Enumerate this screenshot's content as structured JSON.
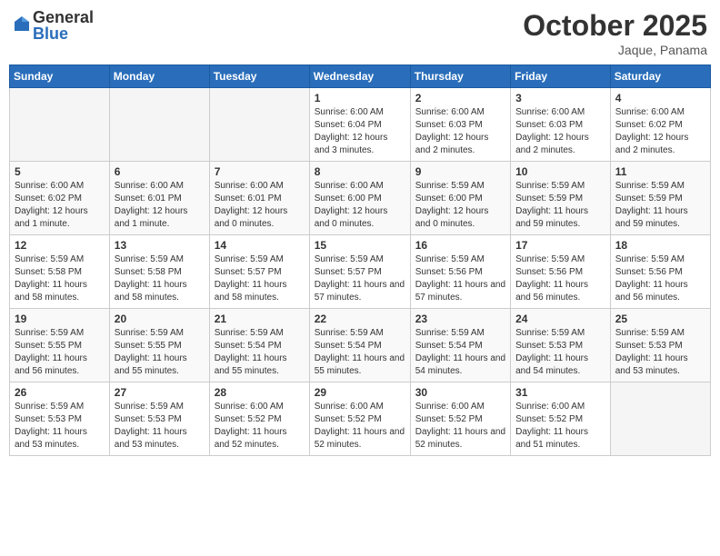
{
  "header": {
    "logo_general": "General",
    "logo_blue": "Blue",
    "month_title": "October 2025",
    "location": "Jaque, Panama"
  },
  "days_of_week": [
    "Sunday",
    "Monday",
    "Tuesday",
    "Wednesday",
    "Thursday",
    "Friday",
    "Saturday"
  ],
  "weeks": [
    [
      {
        "day": "",
        "info": ""
      },
      {
        "day": "",
        "info": ""
      },
      {
        "day": "",
        "info": ""
      },
      {
        "day": "1",
        "info": "Sunrise: 6:00 AM\nSunset: 6:04 PM\nDaylight: 12 hours and 3 minutes."
      },
      {
        "day": "2",
        "info": "Sunrise: 6:00 AM\nSunset: 6:03 PM\nDaylight: 12 hours and 2 minutes."
      },
      {
        "day": "3",
        "info": "Sunrise: 6:00 AM\nSunset: 6:03 PM\nDaylight: 12 hours and 2 minutes."
      },
      {
        "day": "4",
        "info": "Sunrise: 6:00 AM\nSunset: 6:02 PM\nDaylight: 12 hours and 2 minutes."
      }
    ],
    [
      {
        "day": "5",
        "info": "Sunrise: 6:00 AM\nSunset: 6:02 PM\nDaylight: 12 hours and 1 minute."
      },
      {
        "day": "6",
        "info": "Sunrise: 6:00 AM\nSunset: 6:01 PM\nDaylight: 12 hours and 1 minute."
      },
      {
        "day": "7",
        "info": "Sunrise: 6:00 AM\nSunset: 6:01 PM\nDaylight: 12 hours and 0 minutes."
      },
      {
        "day": "8",
        "info": "Sunrise: 6:00 AM\nSunset: 6:00 PM\nDaylight: 12 hours and 0 minutes."
      },
      {
        "day": "9",
        "info": "Sunrise: 5:59 AM\nSunset: 6:00 PM\nDaylight: 12 hours and 0 minutes."
      },
      {
        "day": "10",
        "info": "Sunrise: 5:59 AM\nSunset: 5:59 PM\nDaylight: 11 hours and 59 minutes."
      },
      {
        "day": "11",
        "info": "Sunrise: 5:59 AM\nSunset: 5:59 PM\nDaylight: 11 hours and 59 minutes."
      }
    ],
    [
      {
        "day": "12",
        "info": "Sunrise: 5:59 AM\nSunset: 5:58 PM\nDaylight: 11 hours and 58 minutes."
      },
      {
        "day": "13",
        "info": "Sunrise: 5:59 AM\nSunset: 5:58 PM\nDaylight: 11 hours and 58 minutes."
      },
      {
        "day": "14",
        "info": "Sunrise: 5:59 AM\nSunset: 5:57 PM\nDaylight: 11 hours and 58 minutes."
      },
      {
        "day": "15",
        "info": "Sunrise: 5:59 AM\nSunset: 5:57 PM\nDaylight: 11 hours and 57 minutes."
      },
      {
        "day": "16",
        "info": "Sunrise: 5:59 AM\nSunset: 5:56 PM\nDaylight: 11 hours and 57 minutes."
      },
      {
        "day": "17",
        "info": "Sunrise: 5:59 AM\nSunset: 5:56 PM\nDaylight: 11 hours and 56 minutes."
      },
      {
        "day": "18",
        "info": "Sunrise: 5:59 AM\nSunset: 5:56 PM\nDaylight: 11 hours and 56 minutes."
      }
    ],
    [
      {
        "day": "19",
        "info": "Sunrise: 5:59 AM\nSunset: 5:55 PM\nDaylight: 11 hours and 56 minutes."
      },
      {
        "day": "20",
        "info": "Sunrise: 5:59 AM\nSunset: 5:55 PM\nDaylight: 11 hours and 55 minutes."
      },
      {
        "day": "21",
        "info": "Sunrise: 5:59 AM\nSunset: 5:54 PM\nDaylight: 11 hours and 55 minutes."
      },
      {
        "day": "22",
        "info": "Sunrise: 5:59 AM\nSunset: 5:54 PM\nDaylight: 11 hours and 55 minutes."
      },
      {
        "day": "23",
        "info": "Sunrise: 5:59 AM\nSunset: 5:54 PM\nDaylight: 11 hours and 54 minutes."
      },
      {
        "day": "24",
        "info": "Sunrise: 5:59 AM\nSunset: 5:53 PM\nDaylight: 11 hours and 54 minutes."
      },
      {
        "day": "25",
        "info": "Sunrise: 5:59 AM\nSunset: 5:53 PM\nDaylight: 11 hours and 53 minutes."
      }
    ],
    [
      {
        "day": "26",
        "info": "Sunrise: 5:59 AM\nSunset: 5:53 PM\nDaylight: 11 hours and 53 minutes."
      },
      {
        "day": "27",
        "info": "Sunrise: 5:59 AM\nSunset: 5:53 PM\nDaylight: 11 hours and 53 minutes."
      },
      {
        "day": "28",
        "info": "Sunrise: 6:00 AM\nSunset: 5:52 PM\nDaylight: 11 hours and 52 minutes."
      },
      {
        "day": "29",
        "info": "Sunrise: 6:00 AM\nSunset: 5:52 PM\nDaylight: 11 hours and 52 minutes."
      },
      {
        "day": "30",
        "info": "Sunrise: 6:00 AM\nSunset: 5:52 PM\nDaylight: 11 hours and 52 minutes."
      },
      {
        "day": "31",
        "info": "Sunrise: 6:00 AM\nSunset: 5:52 PM\nDaylight: 11 hours and 51 minutes."
      },
      {
        "day": "",
        "info": ""
      }
    ]
  ]
}
